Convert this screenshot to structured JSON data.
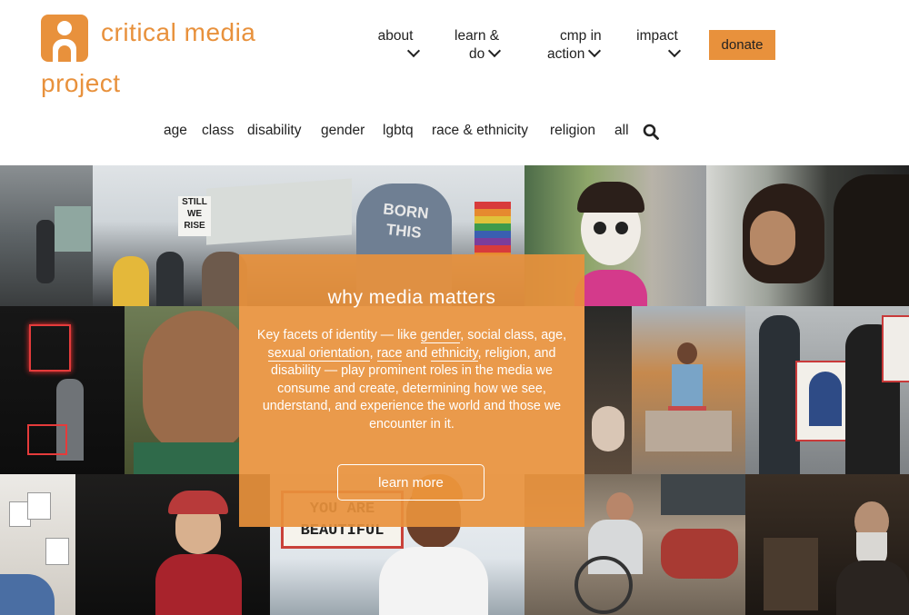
{
  "logo": {
    "line1": "critical media",
    "line2": "project"
  },
  "nav": {
    "about": "about",
    "learn_do_1": "learn &",
    "learn_do_2": "do",
    "cmp_1": "cmp in",
    "cmp_2": "action",
    "impact": "impact",
    "donate": "donate"
  },
  "categories": [
    "age",
    "class",
    "disability",
    "gender",
    "lgbtq",
    "race & ethnicity",
    "religion",
    "all"
  ],
  "hero": {
    "title": "why media matters",
    "body_1": "Key facets of identity — like ",
    "link_gender": "gender",
    "body_2": ", social class, age, ",
    "link_orientation": "sexual orientation",
    "body_3": ", ",
    "link_race": "race",
    "body_4": " and ",
    "link_ethnicity": "ethnicity",
    "body_5": ", religion, and disability — play prominent roles in the media we consume and create, determining how we see, understand, and experience the world and those we encounter in it.",
    "button": "learn more"
  },
  "photos": {
    "protest_sign": "STILL WE RISE",
    "jacket_text": "BORN THIS",
    "billboard": "YOU ARE BEAUTIFUL"
  },
  "colors": {
    "accent": "#e8913c",
    "text": "#222222"
  }
}
